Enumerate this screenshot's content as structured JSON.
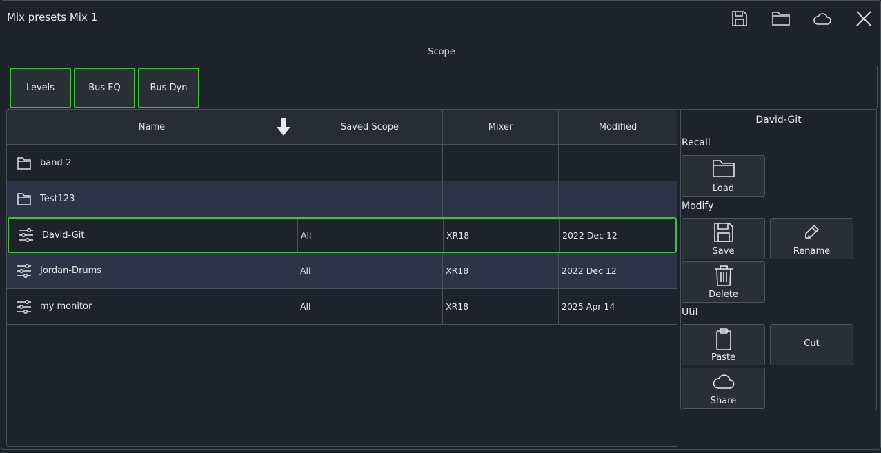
{
  "window": {
    "title": "Mix presets Mix 1",
    "header_icons": [
      "save-icon",
      "folder-icon",
      "cloud-icon",
      "close-icon"
    ]
  },
  "scope": {
    "label": "Scope",
    "buttons": [
      "Levels",
      "Bus EQ",
      "Bus Dyn"
    ],
    "active_color": "#3ec23e"
  },
  "table": {
    "columns": [
      "Name",
      "Saved Scope",
      "Mixer",
      "Modified"
    ],
    "sort": "name-descending",
    "rows": [
      {
        "icon": "folder-icon",
        "name": "band-2",
        "scope": "",
        "mixer": "",
        "modified": ""
      },
      {
        "icon": "folder-icon",
        "name": "Test123",
        "scope": "",
        "mixer": "",
        "modified": ""
      },
      {
        "icon": "sliders-icon",
        "name": "David-Git",
        "scope": "All",
        "mixer": "XR18",
        "modified": "2022 Dec 12"
      },
      {
        "icon": "sliders-icon",
        "name": "Jordan-Drums",
        "scope": "All",
        "mixer": "XR18",
        "modified": "2022 Dec 12"
      },
      {
        "icon": "sliders-icon",
        "name": "my monitor",
        "scope": "All",
        "mixer": "XR18",
        "modified": "2025 Apr 14"
      }
    ],
    "selected": "David-Git"
  },
  "side": {
    "title": "David-Git",
    "recall_label": "Recall",
    "modify_label": "Modify",
    "util_label": "Util",
    "load": "Load",
    "save": "Save",
    "rename": "Rename",
    "delete": "Delete",
    "paste": "Paste",
    "cut": "Cut",
    "share": "Share"
  },
  "colors": {
    "background": "#1e222b",
    "alt_row": "#2e3448",
    "accent": "#3ec23e"
  }
}
